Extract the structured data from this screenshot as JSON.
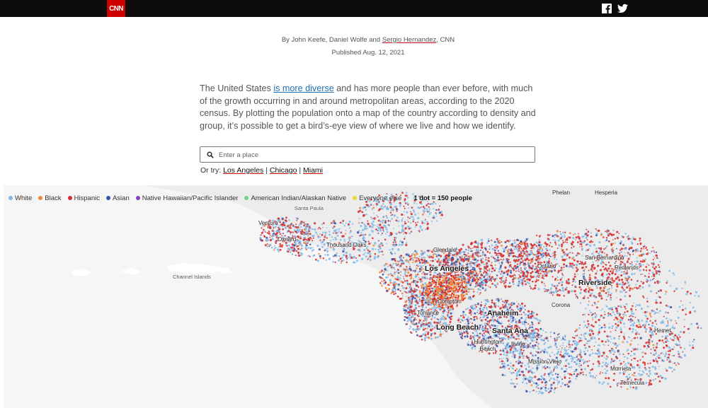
{
  "header": {
    "logo_text": "CNN",
    "social": [
      "facebook-icon",
      "twitter-icon"
    ]
  },
  "byline": {
    "prefix": "By John Keefe, Daniel Wolfe and ",
    "highlight": "Sergio Hernandez",
    "suffix": ", CNN",
    "published": "Published Aug. 12, 2021"
  },
  "intro": {
    "before_link": "The United States ",
    "link": "is more diverse",
    "after_link": " and has more people than ever before, with much of the growth occurring in and around metropolitan areas, according to the 2020 census. By plotting the population onto a map of the country according to density and group, it’s possible to get a bird’s-eye view of where we live and how we identify."
  },
  "search": {
    "placeholder": "Enter a place",
    "value": ""
  },
  "try": {
    "label": "Or try:",
    "links": [
      "Los Angeles",
      "Chicago",
      "Miami"
    ],
    "separator": "|"
  },
  "legend": {
    "items": [
      {
        "label": "White",
        "color": "#7fb8e8"
      },
      {
        "label": "Black",
        "color": "#f08a3c"
      },
      {
        "label": "Hispanic",
        "color": "#d62a2a"
      },
      {
        "label": "Asian",
        "color": "#3a4fa8"
      },
      {
        "label": "Native Hawaiian/Pacific Islander",
        "color": "#8a3fc2"
      },
      {
        "label": "American Indian/Alaskan Native",
        "color": "#6fd08c"
      },
      {
        "label": "Everyone else",
        "color": "#f2d43a"
      }
    ],
    "scale": "1 dot = 150 people"
  },
  "map": {
    "cities": [
      {
        "name": "Phelan",
        "cls": "small"
      },
      {
        "name": "Hesperia",
        "cls": "small"
      },
      {
        "name": "Santa Paula",
        "cls": "grey"
      },
      {
        "name": "Ventura",
        "cls": "small"
      },
      {
        "name": "Oxnard",
        "cls": "small"
      },
      {
        "name": "Thousand Oaks",
        "cls": "small"
      },
      {
        "name": "Glendale",
        "cls": "small"
      },
      {
        "name": "San Bernardino",
        "cls": "small"
      },
      {
        "name": "Los Angeles",
        "cls": "big"
      },
      {
        "name": "Ontario",
        "cls": "small"
      },
      {
        "name": "Redlands",
        "cls": "small"
      },
      {
        "name": "Channel Islands",
        "cls": "grey"
      },
      {
        "name": "Riverside",
        "cls": "big"
      },
      {
        "name": "Compton",
        "cls": "small"
      },
      {
        "name": "Torrance",
        "cls": "small"
      },
      {
        "name": "Corona",
        "cls": "small"
      },
      {
        "name": "Anaheim",
        "cls": "big"
      },
      {
        "name": "Long Beach",
        "cls": "big"
      },
      {
        "name": "Santa Ana",
        "cls": "big"
      },
      {
        "name": "Hemet",
        "cls": "small"
      },
      {
        "name": "Huntington Beach",
        "cls": "small"
      },
      {
        "name": "Irvine",
        "cls": "small"
      },
      {
        "name": "Mission Viejo",
        "cls": "small"
      },
      {
        "name": "Murrieta",
        "cls": "small"
      },
      {
        "name": "Temecula",
        "cls": "small"
      }
    ]
  }
}
